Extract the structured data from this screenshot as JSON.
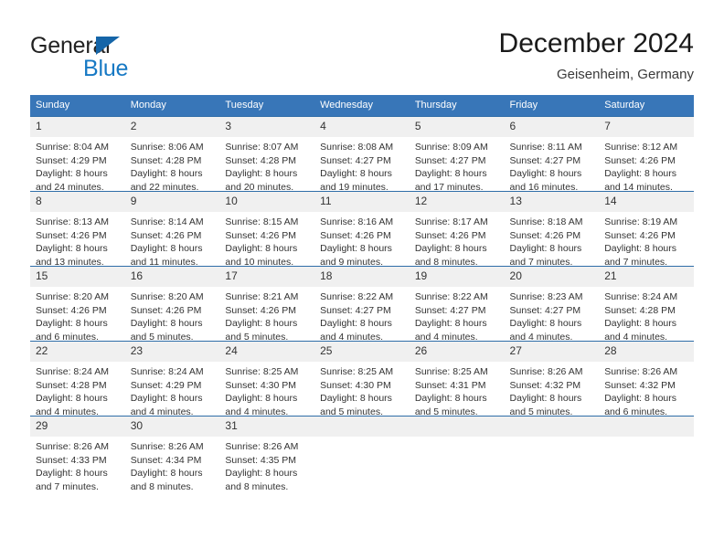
{
  "brand": {
    "word_one": "General",
    "word_two": "Blue",
    "triangle_color": "#1565a8",
    "blue_color": "#1779c4"
  },
  "header": {
    "title": "December 2024",
    "subtitle": "Geisenheim, Germany"
  },
  "theme": {
    "header_blue": "#3876b8",
    "rule_blue": "#2e6da8",
    "daynum_band": "#f0f0f0"
  },
  "weekday_headers": [
    "Sunday",
    "Monday",
    "Tuesday",
    "Wednesday",
    "Thursday",
    "Friday",
    "Saturday"
  ],
  "weeks": [
    [
      {
        "day": "1",
        "sunrise": "Sunrise: 8:04 AM",
        "sunset": "Sunset: 4:29 PM",
        "daylight_1": "Daylight: 8 hours",
        "daylight_2": "and 24 minutes."
      },
      {
        "day": "2",
        "sunrise": "Sunrise: 8:06 AM",
        "sunset": "Sunset: 4:28 PM",
        "daylight_1": "Daylight: 8 hours",
        "daylight_2": "and 22 minutes."
      },
      {
        "day": "3",
        "sunrise": "Sunrise: 8:07 AM",
        "sunset": "Sunset: 4:28 PM",
        "daylight_1": "Daylight: 8 hours",
        "daylight_2": "and 20 minutes."
      },
      {
        "day": "4",
        "sunrise": "Sunrise: 8:08 AM",
        "sunset": "Sunset: 4:27 PM",
        "daylight_1": "Daylight: 8 hours",
        "daylight_2": "and 19 minutes."
      },
      {
        "day": "5",
        "sunrise": "Sunrise: 8:09 AM",
        "sunset": "Sunset: 4:27 PM",
        "daylight_1": "Daylight: 8 hours",
        "daylight_2": "and 17 minutes."
      },
      {
        "day": "6",
        "sunrise": "Sunrise: 8:11 AM",
        "sunset": "Sunset: 4:27 PM",
        "daylight_1": "Daylight: 8 hours",
        "daylight_2": "and 16 minutes."
      },
      {
        "day": "7",
        "sunrise": "Sunrise: 8:12 AM",
        "sunset": "Sunset: 4:26 PM",
        "daylight_1": "Daylight: 8 hours",
        "daylight_2": "and 14 minutes."
      }
    ],
    [
      {
        "day": "8",
        "sunrise": "Sunrise: 8:13 AM",
        "sunset": "Sunset: 4:26 PM",
        "daylight_1": "Daylight: 8 hours",
        "daylight_2": "and 13 minutes."
      },
      {
        "day": "9",
        "sunrise": "Sunrise: 8:14 AM",
        "sunset": "Sunset: 4:26 PM",
        "daylight_1": "Daylight: 8 hours",
        "daylight_2": "and 11 minutes."
      },
      {
        "day": "10",
        "sunrise": "Sunrise: 8:15 AM",
        "sunset": "Sunset: 4:26 PM",
        "daylight_1": "Daylight: 8 hours",
        "daylight_2": "and 10 minutes."
      },
      {
        "day": "11",
        "sunrise": "Sunrise: 8:16 AM",
        "sunset": "Sunset: 4:26 PM",
        "daylight_1": "Daylight: 8 hours",
        "daylight_2": "and 9 minutes."
      },
      {
        "day": "12",
        "sunrise": "Sunrise: 8:17 AM",
        "sunset": "Sunset: 4:26 PM",
        "daylight_1": "Daylight: 8 hours",
        "daylight_2": "and 8 minutes."
      },
      {
        "day": "13",
        "sunrise": "Sunrise: 8:18 AM",
        "sunset": "Sunset: 4:26 PM",
        "daylight_1": "Daylight: 8 hours",
        "daylight_2": "and 7 minutes."
      },
      {
        "day": "14",
        "sunrise": "Sunrise: 8:19 AM",
        "sunset": "Sunset: 4:26 PM",
        "daylight_1": "Daylight: 8 hours",
        "daylight_2": "and 7 minutes."
      }
    ],
    [
      {
        "day": "15",
        "sunrise": "Sunrise: 8:20 AM",
        "sunset": "Sunset: 4:26 PM",
        "daylight_1": "Daylight: 8 hours",
        "daylight_2": "and 6 minutes."
      },
      {
        "day": "16",
        "sunrise": "Sunrise: 8:20 AM",
        "sunset": "Sunset: 4:26 PM",
        "daylight_1": "Daylight: 8 hours",
        "daylight_2": "and 5 minutes."
      },
      {
        "day": "17",
        "sunrise": "Sunrise: 8:21 AM",
        "sunset": "Sunset: 4:26 PM",
        "daylight_1": "Daylight: 8 hours",
        "daylight_2": "and 5 minutes."
      },
      {
        "day": "18",
        "sunrise": "Sunrise: 8:22 AM",
        "sunset": "Sunset: 4:27 PM",
        "daylight_1": "Daylight: 8 hours",
        "daylight_2": "and 4 minutes."
      },
      {
        "day": "19",
        "sunrise": "Sunrise: 8:22 AM",
        "sunset": "Sunset: 4:27 PM",
        "daylight_1": "Daylight: 8 hours",
        "daylight_2": "and 4 minutes."
      },
      {
        "day": "20",
        "sunrise": "Sunrise: 8:23 AM",
        "sunset": "Sunset: 4:27 PM",
        "daylight_1": "Daylight: 8 hours",
        "daylight_2": "and 4 minutes."
      },
      {
        "day": "21",
        "sunrise": "Sunrise: 8:24 AM",
        "sunset": "Sunset: 4:28 PM",
        "daylight_1": "Daylight: 8 hours",
        "daylight_2": "and 4 minutes."
      }
    ],
    [
      {
        "day": "22",
        "sunrise": "Sunrise: 8:24 AM",
        "sunset": "Sunset: 4:28 PM",
        "daylight_1": "Daylight: 8 hours",
        "daylight_2": "and 4 minutes."
      },
      {
        "day": "23",
        "sunrise": "Sunrise: 8:24 AM",
        "sunset": "Sunset: 4:29 PM",
        "daylight_1": "Daylight: 8 hours",
        "daylight_2": "and 4 minutes."
      },
      {
        "day": "24",
        "sunrise": "Sunrise: 8:25 AM",
        "sunset": "Sunset: 4:30 PM",
        "daylight_1": "Daylight: 8 hours",
        "daylight_2": "and 4 minutes."
      },
      {
        "day": "25",
        "sunrise": "Sunrise: 8:25 AM",
        "sunset": "Sunset: 4:30 PM",
        "daylight_1": "Daylight: 8 hours",
        "daylight_2": "and 5 minutes."
      },
      {
        "day": "26",
        "sunrise": "Sunrise: 8:25 AM",
        "sunset": "Sunset: 4:31 PM",
        "daylight_1": "Daylight: 8 hours",
        "daylight_2": "and 5 minutes."
      },
      {
        "day": "27",
        "sunrise": "Sunrise: 8:26 AM",
        "sunset": "Sunset: 4:32 PM",
        "daylight_1": "Daylight: 8 hours",
        "daylight_2": "and 5 minutes."
      },
      {
        "day": "28",
        "sunrise": "Sunrise: 8:26 AM",
        "sunset": "Sunset: 4:32 PM",
        "daylight_1": "Daylight: 8 hours",
        "daylight_2": "and 6 minutes."
      }
    ],
    [
      {
        "day": "29",
        "sunrise": "Sunrise: 8:26 AM",
        "sunset": "Sunset: 4:33 PM",
        "daylight_1": "Daylight: 8 hours",
        "daylight_2": "and 7 minutes."
      },
      {
        "day": "30",
        "sunrise": "Sunrise: 8:26 AM",
        "sunset": "Sunset: 4:34 PM",
        "daylight_1": "Daylight: 8 hours",
        "daylight_2": "and 8 minutes."
      },
      {
        "day": "31",
        "sunrise": "Sunrise: 8:26 AM",
        "sunset": "Sunset: 4:35 PM",
        "daylight_1": "Daylight: 8 hours",
        "daylight_2": "and 8 minutes."
      },
      {
        "day": "",
        "sunrise": "",
        "sunset": "",
        "daylight_1": "",
        "daylight_2": ""
      },
      {
        "day": "",
        "sunrise": "",
        "sunset": "",
        "daylight_1": "",
        "daylight_2": ""
      },
      {
        "day": "",
        "sunrise": "",
        "sunset": "",
        "daylight_1": "",
        "daylight_2": ""
      },
      {
        "day": "",
        "sunrise": "",
        "sunset": "",
        "daylight_1": "",
        "daylight_2": ""
      }
    ]
  ]
}
